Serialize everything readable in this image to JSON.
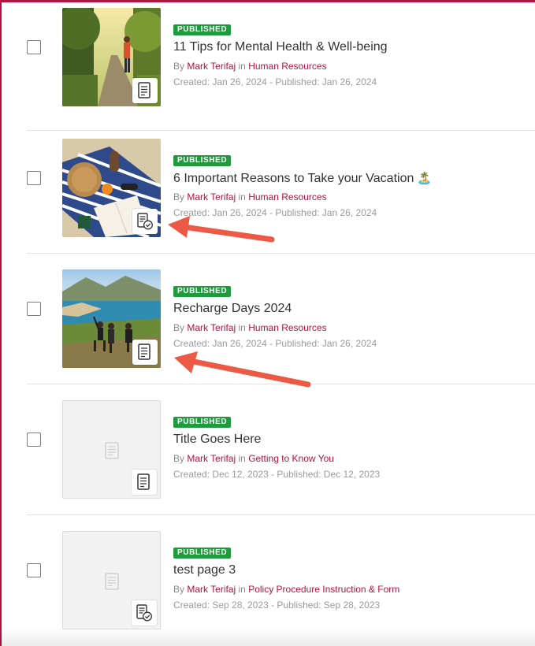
{
  "colors": {
    "accent": "#b5123f",
    "published": "#1f9a3c",
    "annotation_arrow": "#ec5a45"
  },
  "items": [
    {
      "status": "PUBLISHED",
      "title": "11 Tips for Mental Health & Well-being",
      "title_emoji": "",
      "by_prefix": "By",
      "author": "Mark Terifaj",
      "in_word": "in",
      "category": "Human Resources",
      "dates": "Created: Jan 26, 2024 - Published: Jan 26, 2024",
      "thumb": "photo-path",
      "badge_icon": "page-icon"
    },
    {
      "status": "PUBLISHED",
      "title": "6 Important Reasons to Take your Vacation",
      "title_emoji": "🏝️",
      "by_prefix": "By",
      "author": "Mark Terifaj",
      "in_word": "in",
      "category": "Human Resources",
      "dates": "Created: Jan 26, 2024 - Published: Jan 26, 2024",
      "thumb": "photo-picnic",
      "badge_icon": "page-check-icon"
    },
    {
      "status": "PUBLISHED",
      "title": "Recharge Days 2024",
      "title_emoji": "",
      "by_prefix": "By",
      "author": "Mark Terifaj",
      "in_word": "in",
      "category": "Human Resources",
      "dates": "Created: Jan 26, 2024 - Published: Jan 26, 2024",
      "thumb": "photo-coast",
      "badge_icon": "page-icon"
    },
    {
      "status": "PUBLISHED",
      "title": "Title Goes Here",
      "title_emoji": "",
      "by_prefix": "By",
      "author": "Mark Terifaj",
      "in_word": "in",
      "category": "Getting to Know You",
      "dates": "Created: Dec 12, 2023 - Published: Dec 12, 2023",
      "thumb": "placeholder",
      "badge_icon": "page-icon"
    },
    {
      "status": "PUBLISHED",
      "title": "test page 3",
      "title_emoji": "",
      "by_prefix": "By",
      "author": "Mark Terifaj",
      "in_word": "in",
      "category": "Policy Procedure Instruction & Form",
      "dates": "Created: Sep 28, 2023 - Published: Sep 28, 2023",
      "thumb": "placeholder",
      "badge_icon": "page-check-icon"
    }
  ]
}
